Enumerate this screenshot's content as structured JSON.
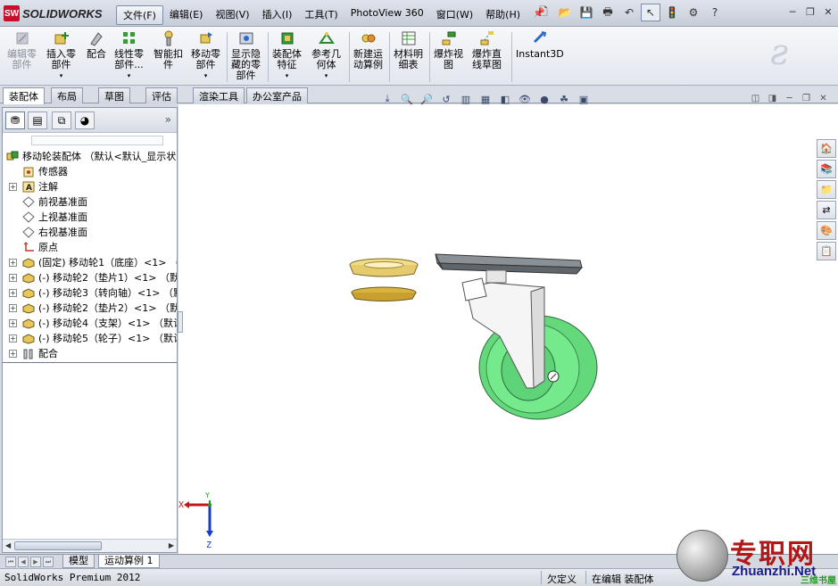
{
  "app": {
    "brand": "SOLIDWORKS"
  },
  "menu": [
    "文件(F)",
    "编辑(E)",
    "视图(V)",
    "插入(I)",
    "工具(T)",
    "PhotoView 360",
    "窗口(W)",
    "帮助(H)"
  ],
  "ribbon": [
    {
      "label": "编辑零\n部件",
      "icon": "edit-component-icon",
      "disabled": true
    },
    {
      "label": "插入零\n部件",
      "icon": "insert-component-icon"
    },
    {
      "label": "配合",
      "icon": "mate-icon"
    },
    {
      "label": "线性零\n部件...",
      "icon": "linear-pattern-icon"
    },
    {
      "label": "智能扣\n件",
      "icon": "smart-fastener-icon"
    },
    {
      "label": "移动零\n部件",
      "icon": "move-component-icon"
    },
    {
      "label": "显示隐\n藏的零\n部件",
      "icon": "show-hidden-icon"
    },
    {
      "label": "装配体\n特征",
      "icon": "assembly-feature-icon"
    },
    {
      "label": "参考几\n何体",
      "icon": "reference-geometry-icon"
    },
    {
      "label": "新建运\n动算例",
      "icon": "new-motion-study-icon"
    },
    {
      "label": "材料明\n细表",
      "icon": "bom-icon"
    },
    {
      "label": "爆炸视\n图",
      "icon": "exploded-view-icon"
    },
    {
      "label": "爆炸直\n线草图",
      "icon": "explode-line-sketch-icon"
    },
    {
      "label": "Instant3D",
      "icon": "instant3d-icon"
    }
  ],
  "command_tabs": [
    "装配体",
    "布局",
    "草图",
    "评估",
    "渲染工具",
    "办公室产品"
  ],
  "tree": {
    "root": "移动轮装配体 （默认<默认_显示状",
    "items": [
      {
        "label": "传感器",
        "icon": "sensor-icon",
        "expand": false
      },
      {
        "label": "注解",
        "icon": "annotation-icon",
        "expand": true
      },
      {
        "label": "前视基准面",
        "icon": "plane-icon",
        "expand": false
      },
      {
        "label": "上视基准面",
        "icon": "plane-icon",
        "expand": false
      },
      {
        "label": "右视基准面",
        "icon": "plane-icon",
        "expand": false
      },
      {
        "label": "原点",
        "icon": "origin-icon",
        "expand": false
      },
      {
        "label": "(固定) 移动轮1（底座）<1> （",
        "icon": "part-icon",
        "expand": true
      },
      {
        "label": "(-) 移动轮2（垫片1）<1> （默",
        "icon": "part-icon",
        "expand": true
      },
      {
        "label": "(-) 移动轮3（转向轴）<1> （默",
        "icon": "part-icon",
        "expand": true
      },
      {
        "label": "(-) 移动轮2（垫片2）<1> （默",
        "icon": "part-icon",
        "expand": true
      },
      {
        "label": "(-) 移动轮4（支架）<1> （默认",
        "icon": "part-icon",
        "expand": true
      },
      {
        "label": "(-) 移动轮5（轮子）<1> （默认",
        "icon": "part-icon",
        "expand": true
      },
      {
        "label": "配合",
        "icon": "mates-folder-icon",
        "expand": true
      }
    ]
  },
  "bottom_tabs": [
    "模型",
    "运动算例 1"
  ],
  "status": {
    "product": "SolidWorks Premium 2012",
    "state": "欠定义",
    "mode": "在编辑 装配体"
  },
  "triad": {
    "x": "X",
    "y": "Y",
    "z": "Z"
  },
  "watermark": {
    "cn": "专职网",
    "url": "Zhuanzhi.Net",
    "green": "三维书屋"
  },
  "colors": {
    "wheel": "#6ee38a",
    "washer": "#e8cf7a",
    "bracket": "#f4f4f4",
    "plate": "#7a8186",
    "brand_red": "#c8102e"
  }
}
